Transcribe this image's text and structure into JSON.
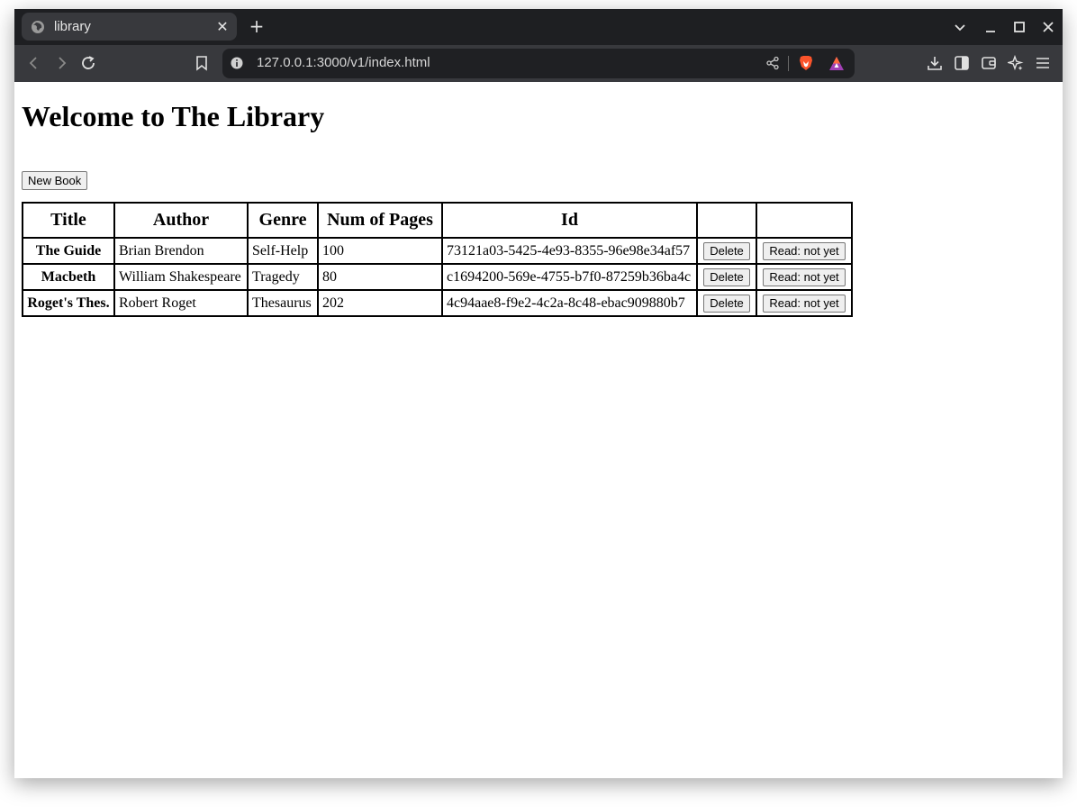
{
  "browser": {
    "tab_title": "library",
    "tab_close": "✕",
    "new_tab": "+",
    "url": "127.0.0.1:3000/v1/index.html"
  },
  "page": {
    "heading": "Welcome to The Library",
    "new_book_label": "New Book",
    "table": {
      "headers": [
        "Title",
        "Author",
        "Genre",
        "Num of Pages",
        "Id",
        "",
        ""
      ],
      "rows": [
        {
          "title": "The Guide",
          "author": "Brian Brendon",
          "genre": "Self-Help",
          "pages": "100",
          "id": "73121a03-5425-4e93-8355-96e98e34af57",
          "delete_label": "Delete",
          "read_label": "Read: not yet"
        },
        {
          "title": "Macbeth",
          "author": "William Shakespeare",
          "genre": "Tragedy",
          "pages": "80",
          "id": "c1694200-569e-4755-b7f0-87259b36ba4c",
          "delete_label": "Delete",
          "read_label": "Read: not yet"
        },
        {
          "title": "Roget's Thes.",
          "author": "Robert Roget",
          "genre": "Thesaurus",
          "pages": "202",
          "id": "4c94aae8-f9e2-4c2a-8c48-ebac909880b7",
          "delete_label": "Delete",
          "read_label": "Read: not yet"
        }
      ]
    }
  },
  "icons": {
    "tab_favicon": "globe-icon",
    "back": "back-arrow-icon",
    "forward": "forward-arrow-icon",
    "reload": "reload-icon",
    "bookmark": "bookmark-icon",
    "site_info": "info-icon",
    "share": "share-icon",
    "brave_shields": "brave-lion-icon",
    "brave_rewards": "brave-rewards-icon",
    "downloads": "download-icon",
    "sidebar": "sidebar-icon",
    "wallet": "wallet-icon",
    "leo": "sparkle-icon",
    "menu": "hamburger-menu-icon",
    "tab_list": "chevron-down-icon",
    "minimize": "minimize-icon",
    "maximize": "maximize-icon",
    "close_window": "close-icon"
  },
  "colors": {
    "tab_strip": "#1e1f22",
    "toolbar": "#38393d",
    "urlbar": "#1f2023",
    "brave_orange": "#fb542b"
  }
}
